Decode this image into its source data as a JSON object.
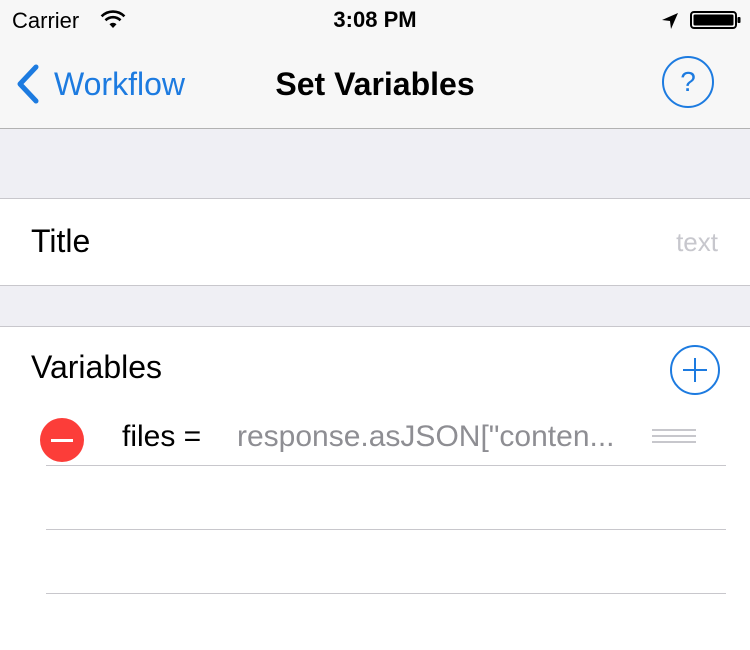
{
  "status_bar": {
    "carrier": "Carrier",
    "time": "3:08 PM",
    "icons": [
      "wifi-icon",
      "location-arrow-icon",
      "battery-icon"
    ]
  },
  "nav": {
    "back_label": "Workflow",
    "title": "Set Variables",
    "help_label": "?",
    "accent_color": "#1d7be0"
  },
  "title_field": {
    "label": "Title",
    "value": "",
    "placeholder": "text"
  },
  "variables": {
    "label": "Variables",
    "items": [
      {
        "name": "files =",
        "value": "response.asJSON[\"conten..."
      }
    ],
    "empty_rows": 2,
    "delete_color": "#fc3d39"
  }
}
